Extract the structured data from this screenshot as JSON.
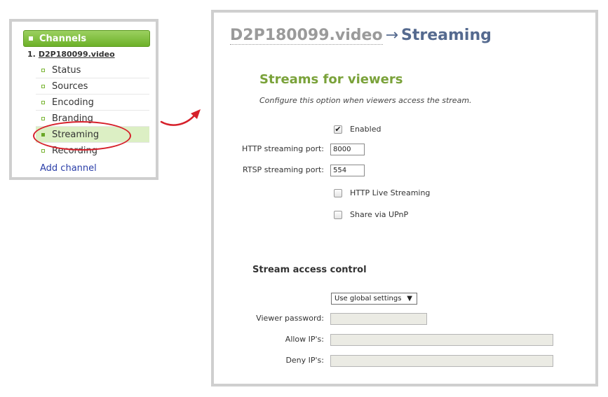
{
  "sidebar": {
    "header": "Channels",
    "channel_prefix": "1.",
    "channel_name": "D2P180099.video",
    "items": [
      {
        "label": "Status"
      },
      {
        "label": "Sources"
      },
      {
        "label": "Encoding"
      },
      {
        "label": "Branding"
      },
      {
        "label": "Streaming"
      },
      {
        "label": "Recording"
      }
    ],
    "active_item": "Streaming",
    "add_label": "Add channel"
  },
  "main": {
    "breadcrumb": {
      "device": "D2P180099.video",
      "separator": "→",
      "page": "Streaming"
    },
    "section_title": "Streams for viewers",
    "section_desc": "Configure this option when viewers access the stream.",
    "enabled_label": "Enabled",
    "enabled_checked": true,
    "http_port_label": "HTTP streaming port:",
    "http_port_value": "8000",
    "rtsp_port_label": "RTSP streaming port:",
    "rtsp_port_value": "554",
    "hls_label": "HTTP Live Streaming",
    "hls_checked": false,
    "upnp_label": "Share via UPnP",
    "upnp_checked": false,
    "access_title": "Stream access control",
    "access_select": "Use global settings",
    "viewer_password_label": "Viewer password:",
    "allow_ips_label": "Allow IP's:",
    "deny_ips_label": "Deny IP's:"
  },
  "colors": {
    "accent_green": "#7aa23a",
    "header_blue": "#556a8f",
    "highlight_red": "#d6202a"
  }
}
